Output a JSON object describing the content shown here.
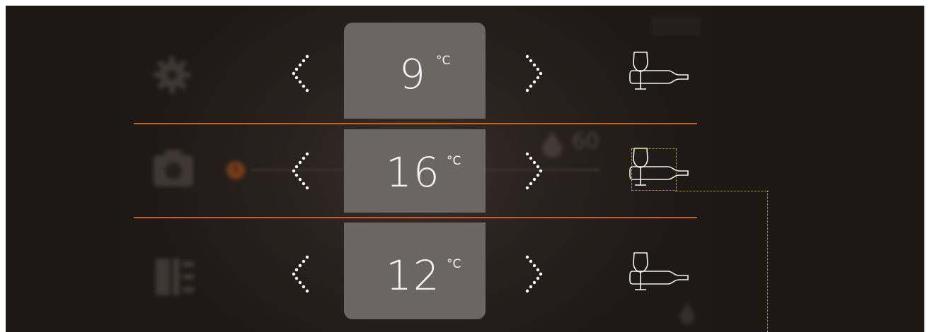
{
  "zones": [
    {
      "name": "top",
      "temperature": "9",
      "unit": "°C"
    },
    {
      "name": "middle",
      "temperature": "16",
      "unit": "°C"
    },
    {
      "name": "bottom",
      "temperature": "12",
      "unit": "°C"
    }
  ],
  "background": {
    "humidity_value": "60"
  },
  "icons": {
    "decrease": "chevron-left-dotted-icon",
    "increase": "chevron-right-dotted-icon",
    "wine": "wine-glass-bottle-icon",
    "settings": "gear-icon",
    "camera": "camera-icon",
    "light": "light-icon",
    "power": "power-icon",
    "humidity": "drop-icon"
  },
  "colors": {
    "screen_background": "#1d1816",
    "temperature_box": "#6b6664",
    "divider": "#c5621d",
    "annotation": "#d4b325",
    "text": "#f2f2f2"
  }
}
